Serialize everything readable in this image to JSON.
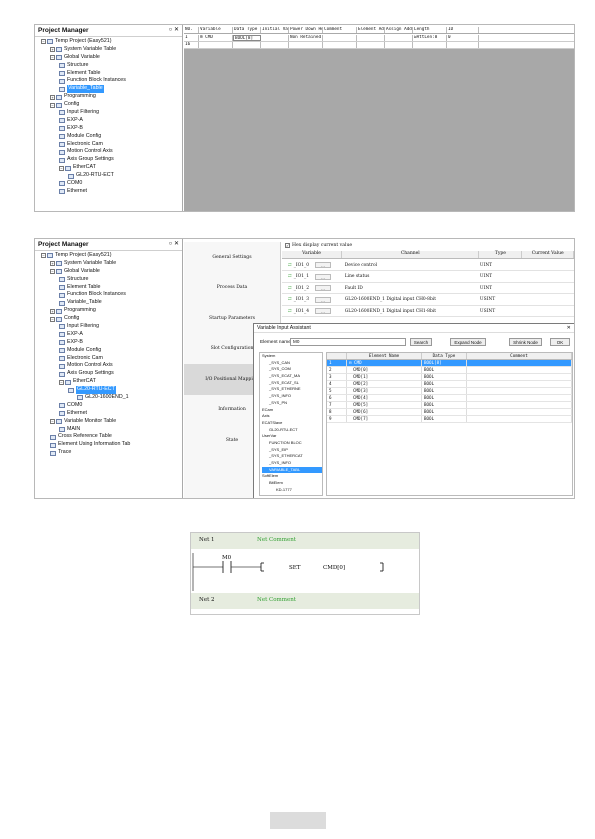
{
  "screen1": {
    "pm_title": "Project Manager",
    "pm_controls": "○ ✕",
    "tree": [
      {
        "label": "Temp Project (Easy521)",
        "exp": "−"
      },
      {
        "label": "System Variable Table",
        "exp": "+"
      },
      {
        "label": "Global Variable",
        "exp": "−"
      },
      {
        "label": "Structure",
        "exp": ""
      },
      {
        "label": "Element Table",
        "exp": ""
      },
      {
        "label": "Function Block Instances",
        "exp": ""
      },
      {
        "label": "Variable_Table",
        "exp": ""
      },
      {
        "label": "Programming",
        "exp": "+"
      },
      {
        "label": "Config",
        "exp": "−"
      },
      {
        "label": "Input Filtering",
        "exp": ""
      },
      {
        "label": "EXP-A",
        "exp": ""
      },
      {
        "label": "EXP-B",
        "exp": ""
      },
      {
        "label": "Module Config",
        "exp": ""
      },
      {
        "label": "Electronic Cam",
        "exp": ""
      },
      {
        "label": "Motion Control Axis",
        "exp": ""
      },
      {
        "label": "Axis Group Settings",
        "exp": ""
      },
      {
        "label": "EtherCAT",
        "exp": "−"
      },
      {
        "label": "GL20-RTU-ECT",
        "exp": ""
      },
      {
        "label": "COM0",
        "exp": ""
      },
      {
        "label": "Ethernet",
        "exp": ""
      }
    ],
    "columns": [
      "NO.",
      "Variable",
      "Data Type",
      "Initial Value",
      "Power Down Hold",
      "Comment",
      "Element Addr.",
      "Assign Addr",
      "Length",
      "ID"
    ],
    "rows": [
      [
        "1",
        "⊞ CMD",
        "BOOL[8]",
        "",
        "Non Retained",
        "",
        "",
        "",
        "wAttLen:8",
        "0"
      ],
      [
        "16",
        "",
        "",
        "",
        "",
        "",
        "",
        "",
        "",
        ""
      ]
    ]
  },
  "screen2": {
    "pm_title": "Project Manager",
    "pm_controls": "○ ✕",
    "tree": [
      {
        "label": "Temp Project (Easy521)",
        "exp": "−"
      },
      {
        "label": "System Variable Table",
        "exp": "+"
      },
      {
        "label": "Global Variable",
        "exp": "−"
      },
      {
        "label": "Structure",
        "exp": ""
      },
      {
        "label": "Element Table",
        "exp": ""
      },
      {
        "label": "Function Block Instances",
        "exp": ""
      },
      {
        "label": "Variable_Table",
        "exp": ""
      },
      {
        "label": "Programming",
        "exp": "+"
      },
      {
        "label": "Config",
        "exp": "−"
      },
      {
        "label": "Input Filtering",
        "exp": ""
      },
      {
        "label": "EXP-A",
        "exp": ""
      },
      {
        "label": "EXP-B",
        "exp": ""
      },
      {
        "label": "Module Config",
        "exp": ""
      },
      {
        "label": "Electronic Cam",
        "exp": ""
      },
      {
        "label": "Motion Control Axis",
        "exp": ""
      },
      {
        "label": "Axis Group Settings",
        "exp": ""
      },
      {
        "label": "EtherCAT",
        "exp": "−"
      },
      {
        "label": "GL20-RTU-ECT",
        "exp": ""
      },
      {
        "label": "GL20-1600END_1",
        "exp": ""
      },
      {
        "label": "COM0",
        "exp": ""
      },
      {
        "label": "Ethernet",
        "exp": ""
      },
      {
        "label": "Variable Monitor Table",
        "exp": "−"
      },
      {
        "label": "MAIN",
        "exp": ""
      },
      {
        "label": "Cross Reference Table",
        "exp": ""
      },
      {
        "label": "Element Using Information Tab",
        "exp": ""
      },
      {
        "label": "Trace",
        "exp": ""
      }
    ],
    "nav": [
      "General Settings",
      "Process Data",
      "Startup Parameters",
      "Slot Configuration",
      "I/O Positional Mapping",
      "Information",
      "State"
    ],
    "hex_display": "Hex display current value",
    "map_columns": [
      "Variable",
      "Channel",
      "Type",
      "Current Value"
    ],
    "map_rows": [
      [
        "_IO1_0",
        "Device control",
        "UINT"
      ],
      [
        "_IO1_1",
        "Line status",
        "UINT"
      ],
      [
        "_IO1_2",
        "Fault ID",
        "UINT"
      ],
      [
        "_IO1_3",
        "GL20-1600END_1 Digital input CH0-8bit",
        "USINT"
      ],
      [
        "_IO1_4",
        "GL20-1600END_1 Digital input CH1-8bit",
        "USINT"
      ]
    ],
    "dialog": {
      "title": "Variable Input Assistant",
      "close": "✕",
      "element_name_label": "Element name:",
      "element_name_value": "M0",
      "search": "Search",
      "expand": "Expand Node",
      "shrink": "Shrink Node",
      "ok": "OK",
      "tree": [
        "System",
        "_SYS_CAN",
        "_SYS_COM",
        "_SYS_ECAT_MA",
        "_SYS_ECAT_SL",
        "_SYS_ETHERNE",
        "_SYS_INFO",
        "_SYS_PN",
        "ECam",
        "Axis",
        "ECATSlave",
        "GL20-RTU-ECT",
        "UserVar",
        "FUNCTION BLOC",
        "_SYS_EIP",
        "_SYS_ETHERCAT",
        "_SYS_INFO",
        "VARIABLE_TABL",
        "SoftElem",
        "BitElem",
        "KD-1777"
      ],
      "columns": [
        "",
        "Element Name",
        "Data Type",
        "Comment"
      ],
      "rows": [
        [
          "1",
          "⊟ CMD",
          "BOOL[8]",
          ""
        ],
        [
          "2",
          "CMD[0]",
          "BOOL",
          ""
        ],
        [
          "3",
          "CMD[1]",
          "BOOL",
          ""
        ],
        [
          "4",
          "CMD[2]",
          "BOOL",
          ""
        ],
        [
          "5",
          "CMD[3]",
          "BOOL",
          ""
        ],
        [
          "6",
          "CMD[4]",
          "BOOL",
          ""
        ],
        [
          "7",
          "CMD[5]",
          "BOOL",
          ""
        ],
        [
          "8",
          "CMD[6]",
          "BOOL",
          ""
        ],
        [
          "9",
          "CMD[7]",
          "BOOL",
          ""
        ]
      ]
    }
  },
  "ladder": {
    "net1": "Net 1",
    "net1_comment": "Net Comment",
    "contact": "M0",
    "instruction": "SET",
    "operand": "CMD[0]",
    "net2": "Net 2",
    "net2_comment": "Net Comment"
  },
  "colors": {
    "selection": "#3399ff",
    "net_bar": "#e6ecdf",
    "comment_green": "#2e9e2e",
    "gray_area": "#a8a8a8"
  }
}
